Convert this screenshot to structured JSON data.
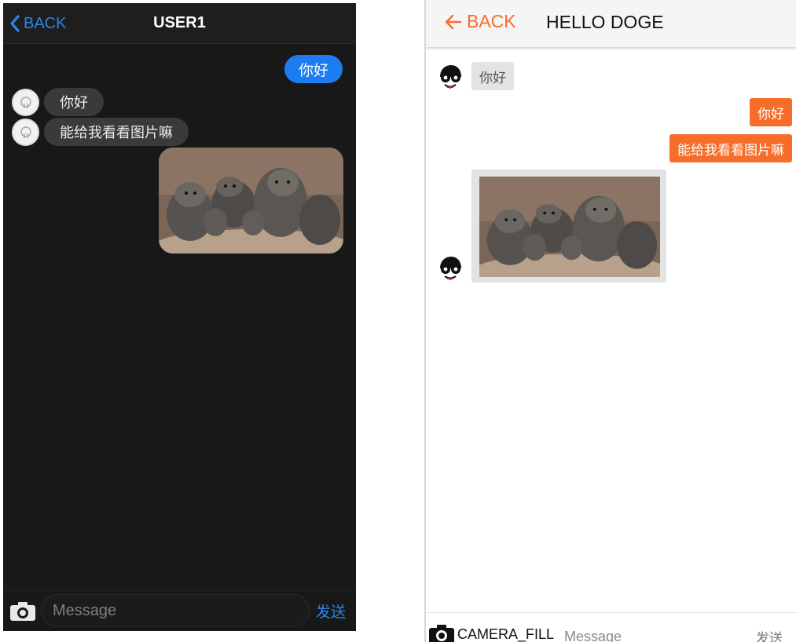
{
  "left_chat": {
    "header": {
      "back_label": "BACK",
      "title": "USER1"
    },
    "messages": [
      {
        "side": "out",
        "text": "你好"
      },
      {
        "side": "in",
        "text": "你好"
      },
      {
        "side": "in",
        "text": "能给我看看图片嘛"
      },
      {
        "side": "out",
        "type": "image"
      }
    ],
    "footer": {
      "input_placeholder": "Message",
      "send_label": "发送"
    },
    "colors": {
      "background": "#181818",
      "accent": "#2b84ea",
      "out_bubble": "#1e7cf2",
      "in_bubble": "#3a3a3a"
    }
  },
  "right_chat": {
    "header": {
      "back_label": "BACK",
      "title": "HELLO DOGE"
    },
    "messages": [
      {
        "side": "in",
        "text": "你好"
      },
      {
        "side": "out",
        "text": "你好"
      },
      {
        "side": "out",
        "text": "能给我看看图片嘛"
      },
      {
        "side": "in",
        "type": "image"
      }
    ],
    "footer": {
      "camera_label": "CAMERA_FILL",
      "input_placeholder": "Message",
      "send_label": "发送"
    },
    "colors": {
      "accent": "#f86d2a",
      "in_bubble": "#e3e3e3",
      "header": "#f5f5f5"
    }
  }
}
